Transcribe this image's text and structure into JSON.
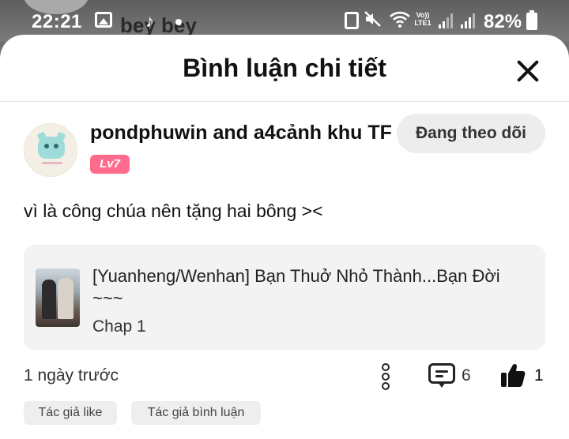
{
  "status_bar": {
    "time": "22:21",
    "background_text": "bey bey",
    "tiktok_icon": "♪",
    "volte_label": "Vo)) LTE1",
    "battery_percent": "82%",
    "icons": [
      "gallery-icon",
      "tiktok-icon",
      "recycle-icon",
      "mute-icon",
      "wifi-icon",
      "signal-icon",
      "battery-icon"
    ]
  },
  "sheet": {
    "title": "Bình luận chi tiết",
    "close_icon": "close-icon"
  },
  "comment": {
    "user_name": "pondphuwin and a4cảnh khu TF",
    "level": "Lv7",
    "follow_button": "Đang theo dõi",
    "text": "vì là công chúa nên tặng hai bông ><",
    "card": {
      "title": "[Yuanheng/Wenhan] Bạn Thuở Nhỏ Thành...Bạn Đời ~~~",
      "chapter": "Chap 1"
    },
    "time_ago": "1 ngày trước",
    "reply_count": "6",
    "like_count": "1",
    "tags": [
      "Tác giả like",
      "Tác giả bình luận"
    ]
  },
  "colors": {
    "level_badge": "#ff6b8c",
    "follow_button_bg": "#ededed",
    "card_bg": "#f3f3f3",
    "status_bar_bg": "#6f6f6f"
  }
}
